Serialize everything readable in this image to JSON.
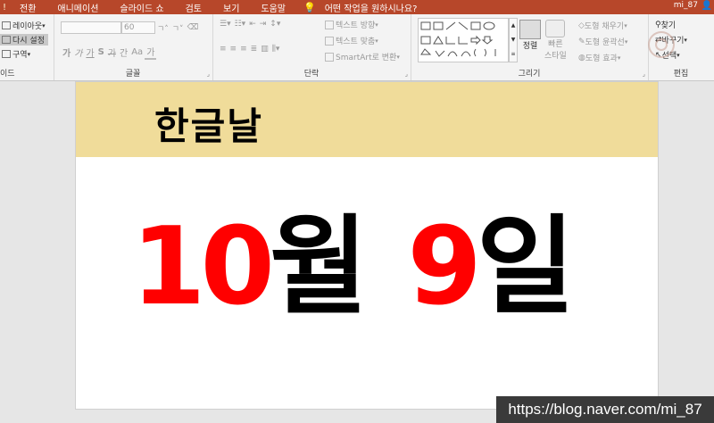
{
  "tabs": {
    "left_edge": "!",
    "items": [
      "전환",
      "애니메이션",
      "슬라이드 쇼",
      "검토",
      "보기",
      "도움말"
    ],
    "tell_me": "어떤 작업을 원하시나요?",
    "user": "mi_87"
  },
  "slide_group": {
    "label": "이드",
    "layout": "레이아웃",
    "reset": "다시 설정",
    "section": "구역"
  },
  "font_group": {
    "label": "글꼴",
    "font_size": "60",
    "buttons": [
      "가",
      "가",
      "가",
      "S",
      "가"
    ],
    "spacing": "간",
    "case": "Aa",
    "color": "가"
  },
  "paragraph_group": {
    "label": "단락",
    "text_direction": "텍스트 방향",
    "align_text": "텍스트 맞춤",
    "smartart": "SmartArt로 변환"
  },
  "drawing_group": {
    "label": "그리기",
    "arrange": "정렬",
    "quick_styles_1": "빠른",
    "quick_styles_2": "스타일",
    "shape_fill": "도형 채우기",
    "shape_outline": "도형 윤곽선",
    "shape_effects": "도형 효과"
  },
  "editing_group": {
    "label": "편집",
    "find": "찾기",
    "replace": "바꾸기",
    "select": "선택"
  },
  "slide": {
    "title": "한글날",
    "date_month_num": "10",
    "date_month_unit": "월",
    "date_day_num": "9",
    "date_day_unit": "일"
  },
  "watermark": "https://blog.naver.com/mi_87",
  "colors": {
    "ribbon_tab": "#b7472a",
    "title_band": "#f0dc9a",
    "highlight_red": "#ff0000"
  }
}
